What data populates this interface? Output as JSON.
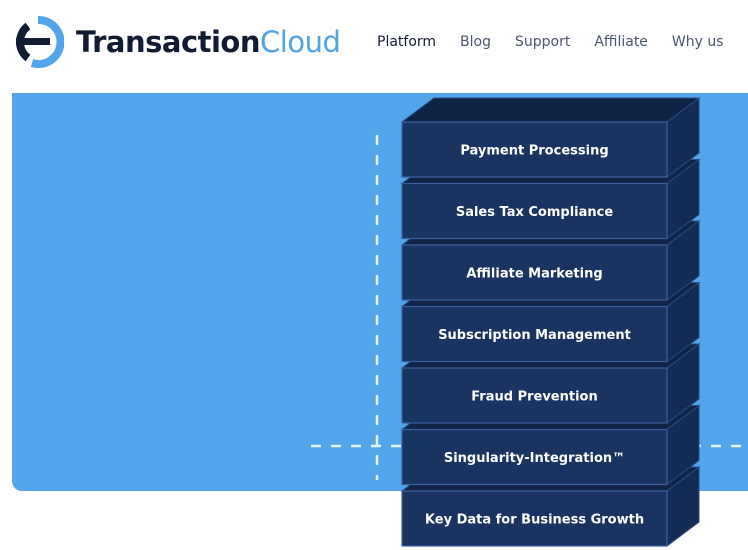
{
  "header": {
    "logo": {
      "primary": "Transaction",
      "secondary": "Cloud"
    },
    "nav": [
      {
        "label": "Platform",
        "active": true
      },
      {
        "label": "Blog"
      },
      {
        "label": "Support"
      },
      {
        "label": "Affiliate"
      },
      {
        "label": "Why us"
      }
    ]
  },
  "stack": {
    "blocks": [
      "Payment Processing",
      "Sales Tax Compliance",
      "Affiliate Marketing",
      "Subscription Management",
      "Fraud Prevention",
      "Singularity-Integration™",
      "Key Data for Business Growth"
    ]
  },
  "colors": {
    "accent": "#52a5ea",
    "brand_dark": "#111c33",
    "block_front": "#1a3461",
    "block_top": "#0f2345",
    "block_side": "#142c55"
  }
}
